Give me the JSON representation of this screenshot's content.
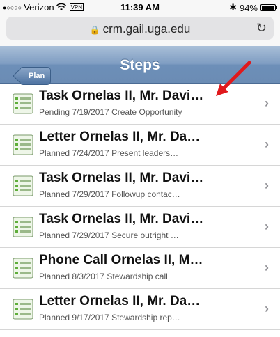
{
  "status_bar": {
    "signal": "●○○○○",
    "carrier": "Verizon",
    "wifi_icon": "wifi-icon",
    "vpn": "VPN",
    "time": "11:39 AM",
    "bluetooth_icon": "bluetooth-icon",
    "battery": "94%"
  },
  "browser": {
    "url": "crm.gail.uga.edu",
    "reload_icon": "reload-icon"
  },
  "navbar": {
    "back_label": "Plan",
    "title": "Steps"
  },
  "steps": [
    {
      "title": "Task Ornelas II, Mr. Davi…",
      "subtitle": "Pending 7/19/2017 Create Opportunity"
    },
    {
      "title": "Letter Ornelas II, Mr. Da…",
      "subtitle": "Planned 7/24/2017 Present leaders…"
    },
    {
      "title": "Task Ornelas II, Mr. Davi…",
      "subtitle": "Planned 7/29/2017 Followup contac…"
    },
    {
      "title": "Task Ornelas II, Mr. Davi…",
      "subtitle": "Planned 7/29/2017 Secure outright …"
    },
    {
      "title": "Phone Call Ornelas II, M…",
      "subtitle": "Planned 8/3/2017 Stewardship call"
    },
    {
      "title": "Letter Ornelas II, Mr. Da…",
      "subtitle": "Planned 9/17/2017 Stewardship rep…"
    }
  ],
  "colors": {
    "navbar": "#7f9dc2",
    "annotation_arrow": "#e0191c"
  }
}
